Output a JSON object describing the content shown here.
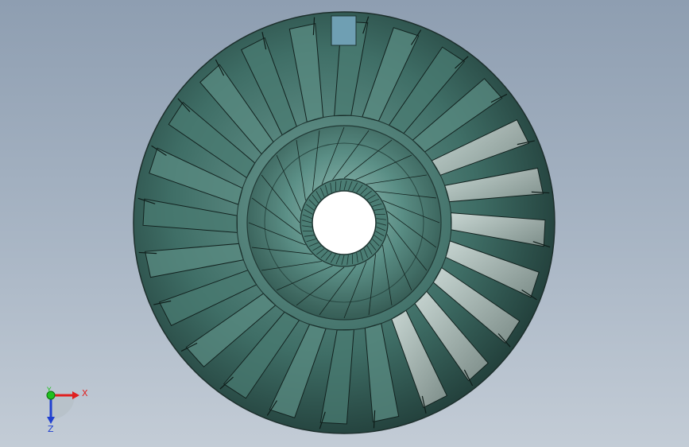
{
  "viewport": {
    "background_top": "#8e9eb1",
    "background_bottom": "#c3ccd6"
  },
  "model": {
    "part": "turbine-wheel",
    "blade_count": 24,
    "body_color": "#3f6e66",
    "highlight_color": "#f2f4f2",
    "rim_color": "#243c38",
    "hub_color": "#5b8f86"
  },
  "triad": {
    "x_label": "X",
    "y_label": "Y",
    "z_label": "Z",
    "x_color": "#e02020",
    "y_color": "#20c020",
    "z_color": "#2040d0"
  }
}
